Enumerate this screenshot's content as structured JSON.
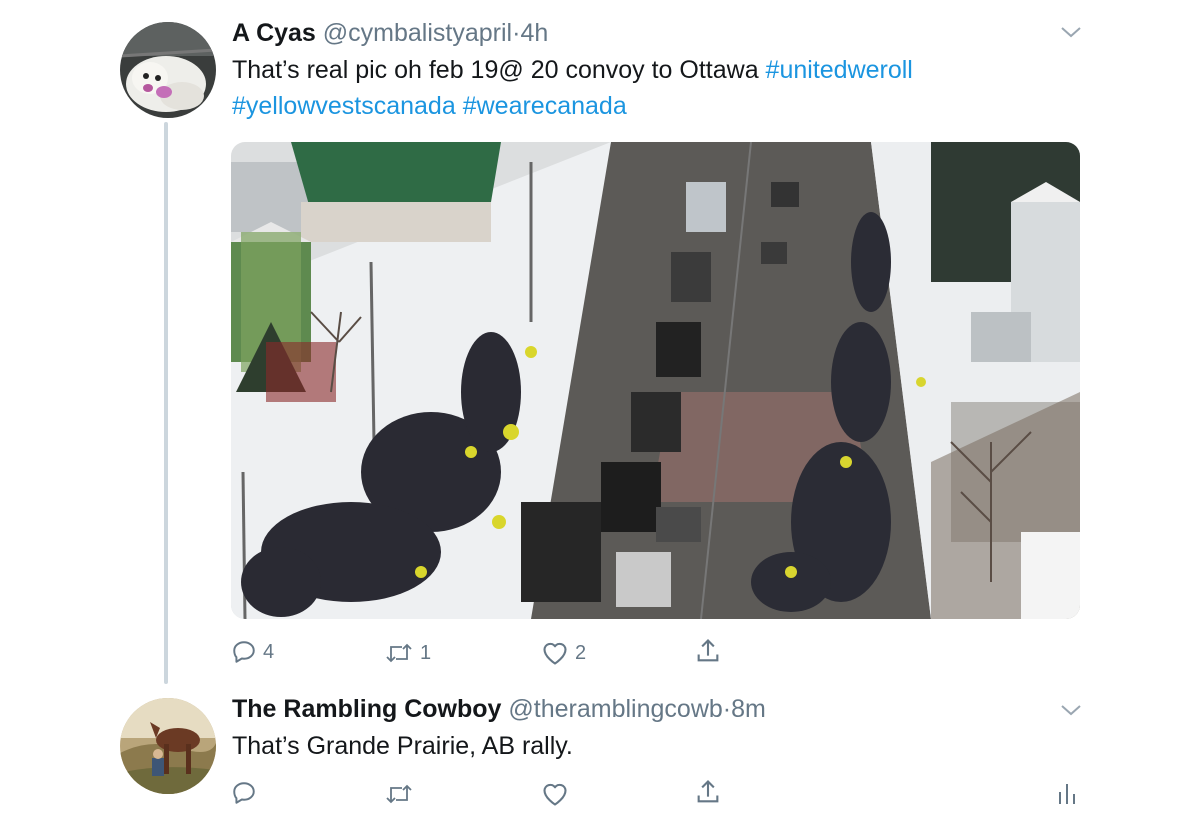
{
  "tweets": [
    {
      "name": "A Cyas",
      "handle": "@cymbalistyapril",
      "separator": "·",
      "time": "4h",
      "text_line1": "That’s real pic oh feb 19@ 20 convoy to Ottawa ",
      "hashtag1": "#unitedweroll",
      "hashtag2": "#yellowvestscanada",
      "hashtag3": "#wearecanada",
      "replies": "4",
      "retweets": "1",
      "likes": "2"
    },
    {
      "name": "The Rambling Cowboy",
      "handle": "@theramblingcowb",
      "separator": "·",
      "time": "8m",
      "text": "That’s Grande Prairie, AB rally."
    }
  ],
  "icons": {
    "reply": "reply-icon",
    "retweet": "retweet-icon",
    "like": "heart-icon",
    "share": "share-icon",
    "analytics": "analytics-icon",
    "more": "chevron-down-icon"
  },
  "colors": {
    "text": "#14171a",
    "secondary": "#657786",
    "link": "#1b95e0",
    "thread_line": "#ccd6dd"
  }
}
